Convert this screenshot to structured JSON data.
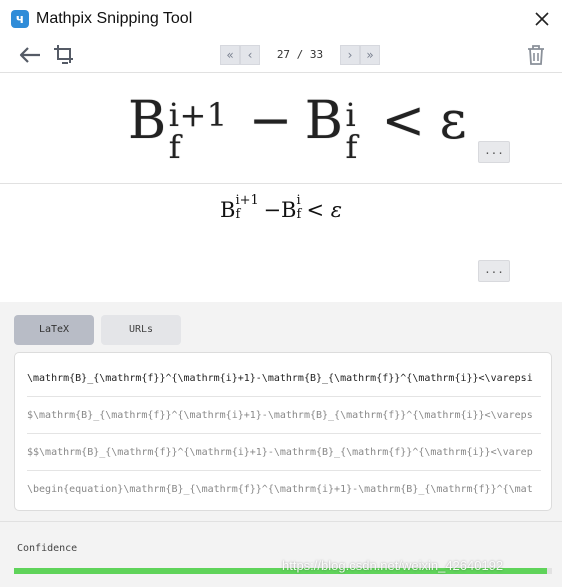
{
  "window": {
    "title": "Mathpix Snipping Tool",
    "logo_glyph": "ч",
    "close_icon": "close-icon"
  },
  "toolbar": {
    "back_icon": "arrow-left-icon",
    "crop_icon": "crop-screen-icon",
    "first_glyph": "«",
    "prev_glyph": "‹",
    "next_glyph": "›",
    "last_glyph": "»",
    "page_current": 27,
    "page_total": 33,
    "page_label": "27 / 33",
    "delete_icon": "trash-icon"
  },
  "preview": {
    "base": "B",
    "sup": "i+1",
    "sub": "f",
    "minus": "−",
    "base2": "B",
    "sup2": "i",
    "sub2": "f",
    "rel": "<",
    "eps": "ε",
    "more_label": "..."
  },
  "rendered": {
    "base": "B",
    "sup": "i+1",
    "sub": "f",
    "minus": "−",
    "base2": "B",
    "sup2": "i",
    "sub2": "f",
    "rel": "<",
    "eps": "ε",
    "more_label": "..."
  },
  "tabs": [
    {
      "label": "LaTeX",
      "active": true
    },
    {
      "label": "URLs",
      "active": false
    }
  ],
  "latex_options": [
    "\\mathrm{B}_{\\mathrm{f}}^{\\mathrm{i}+1}-\\mathrm{B}_{\\mathrm{f}}^{\\mathrm{i}}<\\varepsi",
    "$\\mathrm{B}_{\\mathrm{f}}^{\\mathrm{i}+1}-\\mathrm{B}_{\\mathrm{f}}^{\\mathrm{i}}<\\vareps",
    "$$\\mathrm{B}_{\\mathrm{f}}^{\\mathrm{i}+1}-\\mathrm{B}_{\\mathrm{f}}^{\\mathrm{i}}<\\varep",
    "\\begin{equation}\\mathrm{B}_{\\mathrm{f}}^{\\mathrm{i}+1}-\\mathrm{B}_{\\mathrm{f}}^{\\mat"
  ],
  "confidence": {
    "label": "Confidence",
    "value": 0.99,
    "color": "#5fd35a"
  },
  "watermark": "https://blog.csdn.net/weixin_42640192"
}
